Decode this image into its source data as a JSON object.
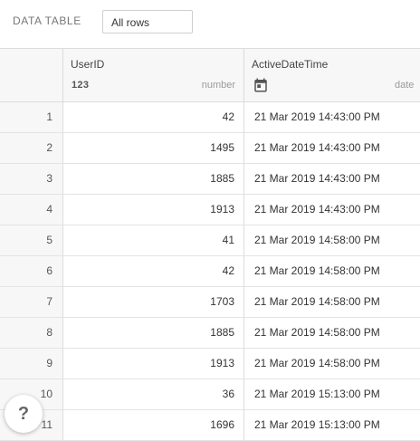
{
  "toolbar": {
    "title": "DATA TABLE",
    "row_filter_value": "All rows"
  },
  "columns": [
    {
      "name": "UserID",
      "type_label": "number",
      "type_icon": "123"
    },
    {
      "name": "ActiveDateTime",
      "type_label": "date",
      "type_icon": "calendar-icon"
    }
  ],
  "rows": [
    {
      "index": "1",
      "userid": "42",
      "active": "21 Mar 2019 14:43:00 PM"
    },
    {
      "index": "2",
      "userid": "1495",
      "active": "21 Mar 2019 14:43:00 PM"
    },
    {
      "index": "3",
      "userid": "1885",
      "active": "21 Mar 2019 14:43:00 PM"
    },
    {
      "index": "4",
      "userid": "1913",
      "active": "21 Mar 2019 14:43:00 PM"
    },
    {
      "index": "5",
      "userid": "41",
      "active": "21 Mar 2019 14:58:00 PM"
    },
    {
      "index": "6",
      "userid": "42",
      "active": "21 Mar 2019 14:58:00 PM"
    },
    {
      "index": "7",
      "userid": "1703",
      "active": "21 Mar 2019 14:58:00 PM"
    },
    {
      "index": "8",
      "userid": "1885",
      "active": "21 Mar 2019 14:58:00 PM"
    },
    {
      "index": "9",
      "userid": "1913",
      "active": "21 Mar 2019 14:58:00 PM"
    },
    {
      "index": "10",
      "userid": "36",
      "active": "21 Mar 2019 15:13:00 PM"
    },
    {
      "index": "11",
      "userid": "1696",
      "active": "21 Mar 2019 15:13:00 PM"
    }
  ],
  "help": {
    "label": "?"
  },
  "colors": {
    "header_bg": "#f7f7f7",
    "border": "#dcdcdc",
    "text": "#333333",
    "muted": "#9a9a9a"
  }
}
